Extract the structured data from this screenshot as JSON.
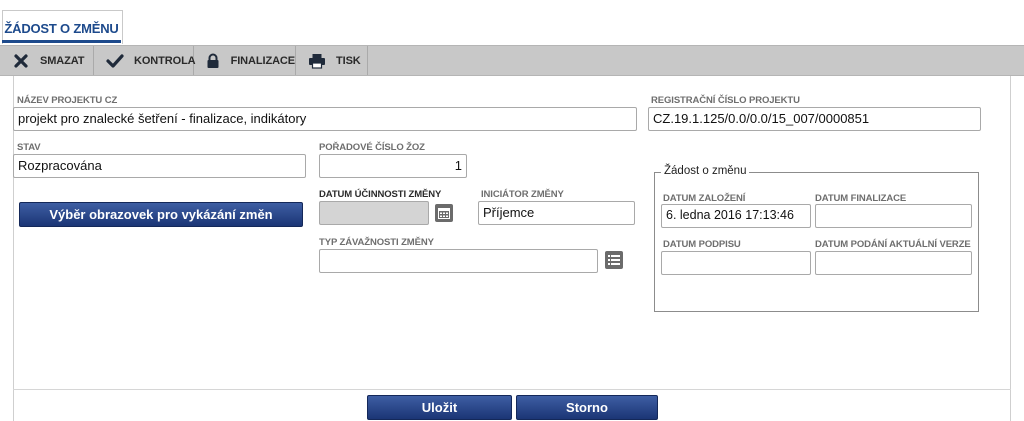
{
  "tab": {
    "label": "ŽÁDOST O ZMĚNU"
  },
  "toolbar": {
    "delete_label": "SMAZAT",
    "check_label": "KONTROLA",
    "finalize_label": "FINALIZACE",
    "print_label": "TISK"
  },
  "form": {
    "project_name": {
      "label": "NÁZEV PROJEKTU CZ",
      "value": "projekt pro znalecké šetření - finalizace, indikátory"
    },
    "reg_number": {
      "label": "REGISTRAČNÍ ČÍSLO PROJEKTU",
      "value": "CZ.19.1.125/0.0/0.0/15_007/0000851"
    },
    "status": {
      "label": "STAV",
      "value": "Rozpracována"
    },
    "order_number": {
      "label": "POŘADOVÉ ČÍSLO ŽOZ",
      "value": "1"
    },
    "effective_date": {
      "label": "DATUM ÚČINNOSTI ZMĚNY",
      "value": ""
    },
    "initiator": {
      "label": "INICIÁTOR ZMĚNY",
      "value": "Příjemce"
    },
    "severity_type": {
      "label": "TYP ZÁVAŽNOSTI ZMĚNY",
      "value": ""
    },
    "select_screens_label": "Výběr obrazovek pro vykázání změn"
  },
  "request_box": {
    "legend": "Žádost o změnu",
    "created_date": {
      "label": "DATUM ZALOŽENÍ",
      "value": "6. ledna 2016 17:13:46"
    },
    "finalized_date": {
      "label": "DATUM FINALIZACE",
      "value": ""
    },
    "signature_date": {
      "label": "DATUM PODPISU",
      "value": ""
    },
    "submit_date": {
      "label": "DATUM PODÁNÍ AKTUÁLNÍ VERZE",
      "value": ""
    }
  },
  "footer": {
    "save_label": "Uložit",
    "cancel_label": "Storno"
  },
  "colors": {
    "accent": "#1d4a8c",
    "button": "#1b3575",
    "toolbar": "#c8c8c8"
  }
}
